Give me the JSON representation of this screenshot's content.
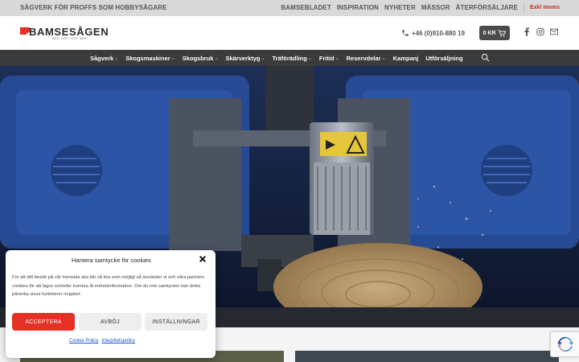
{
  "topbar": {
    "tagline": "SÅGVERK FÖR PROFFS SOM HOBBYSÅGARE",
    "links": [
      "BAMSEBLADET",
      "INSPIRATION",
      "NYHETER",
      "MÄSSOR",
      "ÅTERFÖRSÄLJARE"
    ],
    "vat_toggle": "Exkl moms"
  },
  "header": {
    "logo_text": "BAMSESÅGEN",
    "logo_subtext": "MED FART OCH MER",
    "phone": "+46 (0)910-880 19",
    "cart_total": "0 KR",
    "social_icons": [
      "facebook-icon",
      "instagram-icon",
      "email-icon"
    ]
  },
  "nav": {
    "items": [
      {
        "label": "Sågverk",
        "dropdown": true
      },
      {
        "label": "Skogsmaskiner",
        "dropdown": true
      },
      {
        "label": "Skogsbruk",
        "dropdown": true
      },
      {
        "label": "Skärverktyg",
        "dropdown": true
      },
      {
        "label": "Träförädling",
        "dropdown": true
      },
      {
        "label": "Fritid",
        "dropdown": true
      },
      {
        "label": "Reservdelar",
        "dropdown": true
      },
      {
        "label": "Kampanj",
        "dropdown": false
      },
      {
        "label": "Utförsäljning",
        "dropdown": false
      }
    ]
  },
  "cookie": {
    "title": "Hantera samtycke för cookies",
    "text": "För att ditt besök på vår hemsida ska blir så bra som möjligt så använder vi och våra partners cookies för att lagra och/eller komma åt enhetsinformation. Om du inte samtycker kan detta påverka vissa funktioner negativt.",
    "accept": "ACCEPTERA",
    "deny": "AVBÖJ",
    "settings": "INSTÄLLNINGAR",
    "cookie_policy": "Cookie Policy",
    "privacy_policy": "Integritetspolicy"
  },
  "colors": {
    "brand_red": "#e53124",
    "nav_bg": "#3a3b3c",
    "topbar_bg": "#d9d9d9",
    "machine_blue": "#2a4f9e"
  }
}
